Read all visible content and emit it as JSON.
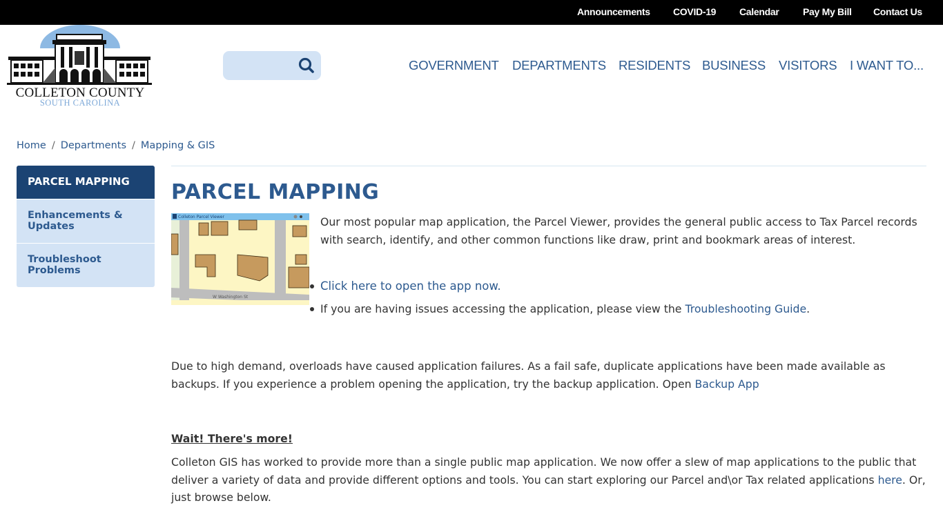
{
  "utility_nav": [
    {
      "label": "Announcements"
    },
    {
      "label": "COVID-19"
    },
    {
      "label": "Calendar"
    },
    {
      "label": "Pay My Bill"
    },
    {
      "label": "Contact Us"
    }
  ],
  "logo": {
    "line1": "COLLETON COUNTY",
    "line2": "SOUTH CAROLINA"
  },
  "search": {
    "value": "",
    "placeholder": "",
    "icon": "search-icon"
  },
  "main_nav": [
    {
      "label": "GOVERNMENT"
    },
    {
      "label": "DEPARTMENTS"
    },
    {
      "label": "RESIDENTS"
    },
    {
      "label": "BUSINESS"
    },
    {
      "label": "VISITORS"
    },
    {
      "label": "I WANT TO..."
    }
  ],
  "breadcrumb": [
    {
      "label": "Home"
    },
    {
      "label": "Departments"
    },
    {
      "label": "Mapping & GIS"
    }
  ],
  "breadcrumb_separator": "/",
  "side_nav": [
    {
      "label": "PARCEL MAPPING",
      "active": true
    },
    {
      "label": "Enhancements & Updates",
      "active": false
    },
    {
      "label": "Troubleshoot Problems",
      "active": false
    }
  ],
  "content": {
    "title": "PARCEL MAPPING",
    "thumbnail": {
      "app_title": "Colleton Parcel Viewer",
      "street_label": "W Washington St"
    },
    "intro": "Our most popular map application, the Parcel Viewer, provides the general public access to Tax Parcel records with search, identify, and other common functions like draw, print and bookmark areas of interest.",
    "bullet1_link": "Click here to open the app now.",
    "bullet2_text": "If you are having issues accessing the application, please view the ",
    "bullet2_link": "Troubleshooting Guide",
    "bullet2_end": ".",
    "demand_text": "Due to high demand, overloads have caused application failures. As a fail safe, duplicate  applications have been made available as backups. If you experience a problem opening the application, try the backup application. Open ",
    "demand_link": "Backup App",
    "more_heading": "Wait! There's more!",
    "more_text": "Colleton GIS has worked to provide more than a single public map application. We now offer a slew of map applications to the public that deliver a variety of data and provide different options and tools. You can start exploring our Parcel and\\or Tax related applications ",
    "more_link": "here",
    "more_end": ". Or, just browse below."
  },
  "colors": {
    "topbar": "#000000",
    "brand_blue": "#2d5a8f",
    "nav_active": "#1b4373",
    "nav_bg": "#d3e3f5",
    "search_bg": "#d3e3f5"
  }
}
